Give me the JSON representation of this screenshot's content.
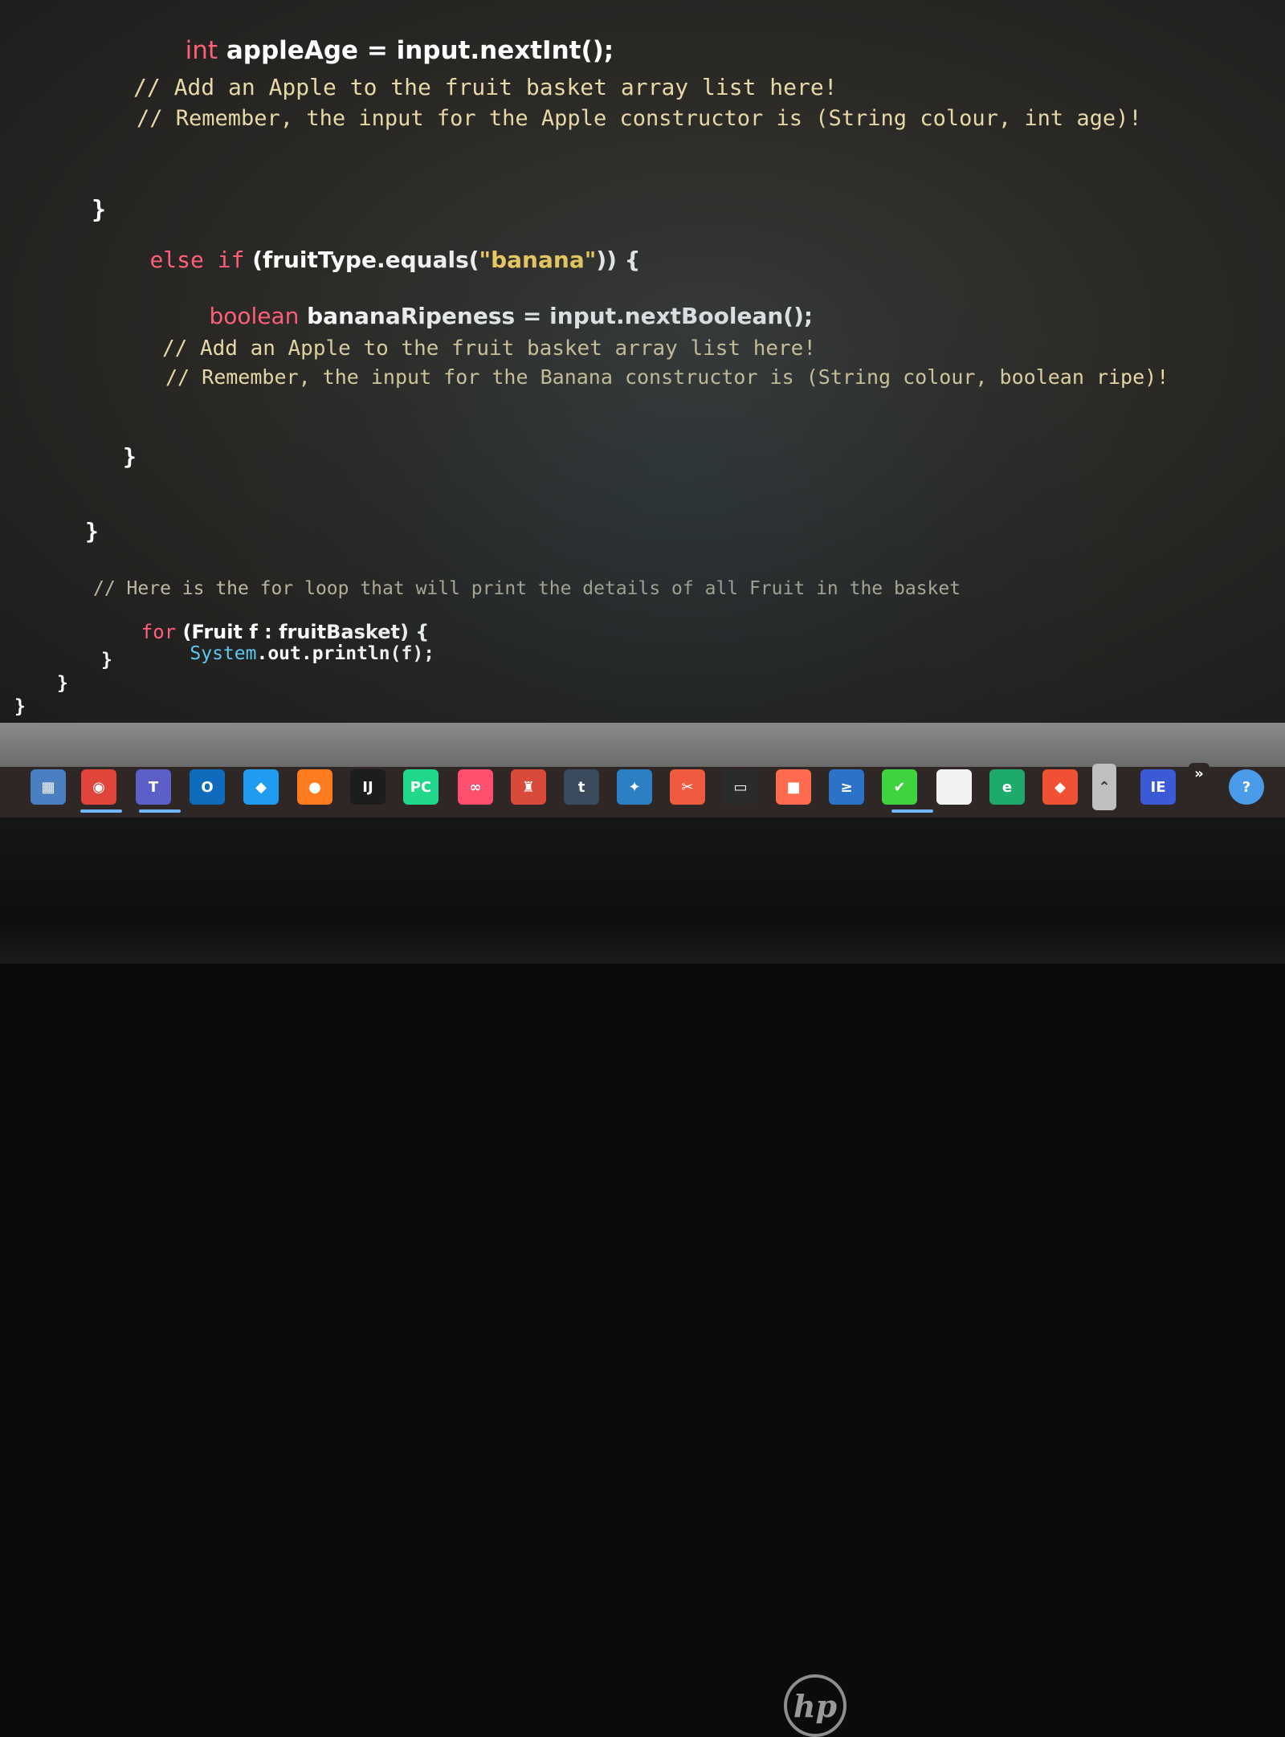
{
  "editor": {
    "lines": [
      {
        "t1": "int",
        "t2": " appleAge",
        "t3": " = ",
        "t4": "input.nextInt();"
      },
      {
        "comment": "// Add an Apple to the fruit basket array list here!"
      },
      {
        "comment": "// Remember, the input for the Apple constructor is (String colour, int age)!"
      },
      {
        "brace": "}"
      },
      {
        "kw": "else if",
        "rest1": " (fruitType.equals(",
        "str": "\"banana\"",
        "rest2": ")) {"
      },
      {
        "t1": "boolean",
        "t2": " bananaRipeness",
        "t3": " = ",
        "t4": "input.nextBoolean();"
      },
      {
        "comment": "// Add an Apple to the fruit basket array list here!"
      },
      {
        "comment": "// Remember, the input for the Banana constructor is (String colour, boolean ripe)!"
      },
      {
        "brace": "}"
      },
      {
        "brace": "}"
      },
      {
        "comment": "// Here is the for loop that will print the details of all Fruit in the basket"
      },
      {
        "kw": "for",
        "rest": " (Fruit f : fruitBasket) {"
      },
      {
        "sys": "System",
        "rest": ".out.println(f);"
      },
      {
        "brace": "}"
      },
      {
        "brace": "}"
      },
      {
        "brace": "}"
      }
    ]
  },
  "taskbar": {
    "icons": [
      {
        "name": "calculator-icon",
        "color": "#4a7fc1",
        "glyph": "▦"
      },
      {
        "name": "chrome-icon",
        "color": "#e0443a",
        "glyph": "◉"
      },
      {
        "name": "teams-icon",
        "color": "#5b5fc7",
        "glyph": "T"
      },
      {
        "name": "outlook-icon",
        "color": "#0f6cbd",
        "glyph": "O"
      },
      {
        "name": "vscode-icon",
        "color": "#1f9cf0",
        "glyph": "◆"
      },
      {
        "name": "firefox-icon",
        "color": "#ff7b1f",
        "glyph": "●"
      },
      {
        "name": "intellij-icon",
        "color": "#1d1d1d",
        "glyph": "IJ"
      },
      {
        "name": "pycharm-icon",
        "color": "#21d789",
        "glyph": "PC"
      },
      {
        "name": "creative-cloud-icon",
        "color": "#ff4f6e",
        "glyph": "∞"
      },
      {
        "name": "popcorn-icon",
        "color": "#d94a3a",
        "glyph": "♜"
      },
      {
        "name": "tumblr-icon",
        "color": "#3b4b5e",
        "glyph": "t"
      },
      {
        "name": "mysql-workbench-icon",
        "color": "#2d7fc4",
        "glyph": "✦"
      },
      {
        "name": "snipping-tool-icon",
        "color": "#f05a40",
        "glyph": "✂"
      },
      {
        "name": "terminal-icon",
        "color": "#2b2b2b",
        "glyph": "▭"
      },
      {
        "name": "chat-app-icon",
        "color": "#ff6b4f",
        "glyph": "■"
      },
      {
        "name": "powershell-icon",
        "color": "#2a73c8",
        "glyph": "≥"
      },
      {
        "name": "android-tool-icon",
        "color": "#3fd43f",
        "glyph": "✔"
      },
      {
        "name": "notepad-icon",
        "color": "#f2f2f2",
        "glyph": " "
      },
      {
        "name": "edge-icon",
        "color": "#1eaa6a",
        "glyph": "e"
      },
      {
        "name": "git-icon",
        "color": "#f05033",
        "glyph": "◆"
      },
      {
        "name": "show-hidden-icons-icon",
        "color": "#bfbfbf",
        "glyph": "⌃"
      },
      {
        "name": "ie-icon",
        "color": "#3a5ad6",
        "glyph": "IE"
      },
      {
        "name": "overflow-chevron-icon",
        "color": "#2e2725",
        "glyph": "»"
      },
      {
        "name": "help-icon",
        "color": "#4a9be8",
        "glyph": "?"
      }
    ]
  },
  "bezel": {
    "logo": "hp"
  }
}
